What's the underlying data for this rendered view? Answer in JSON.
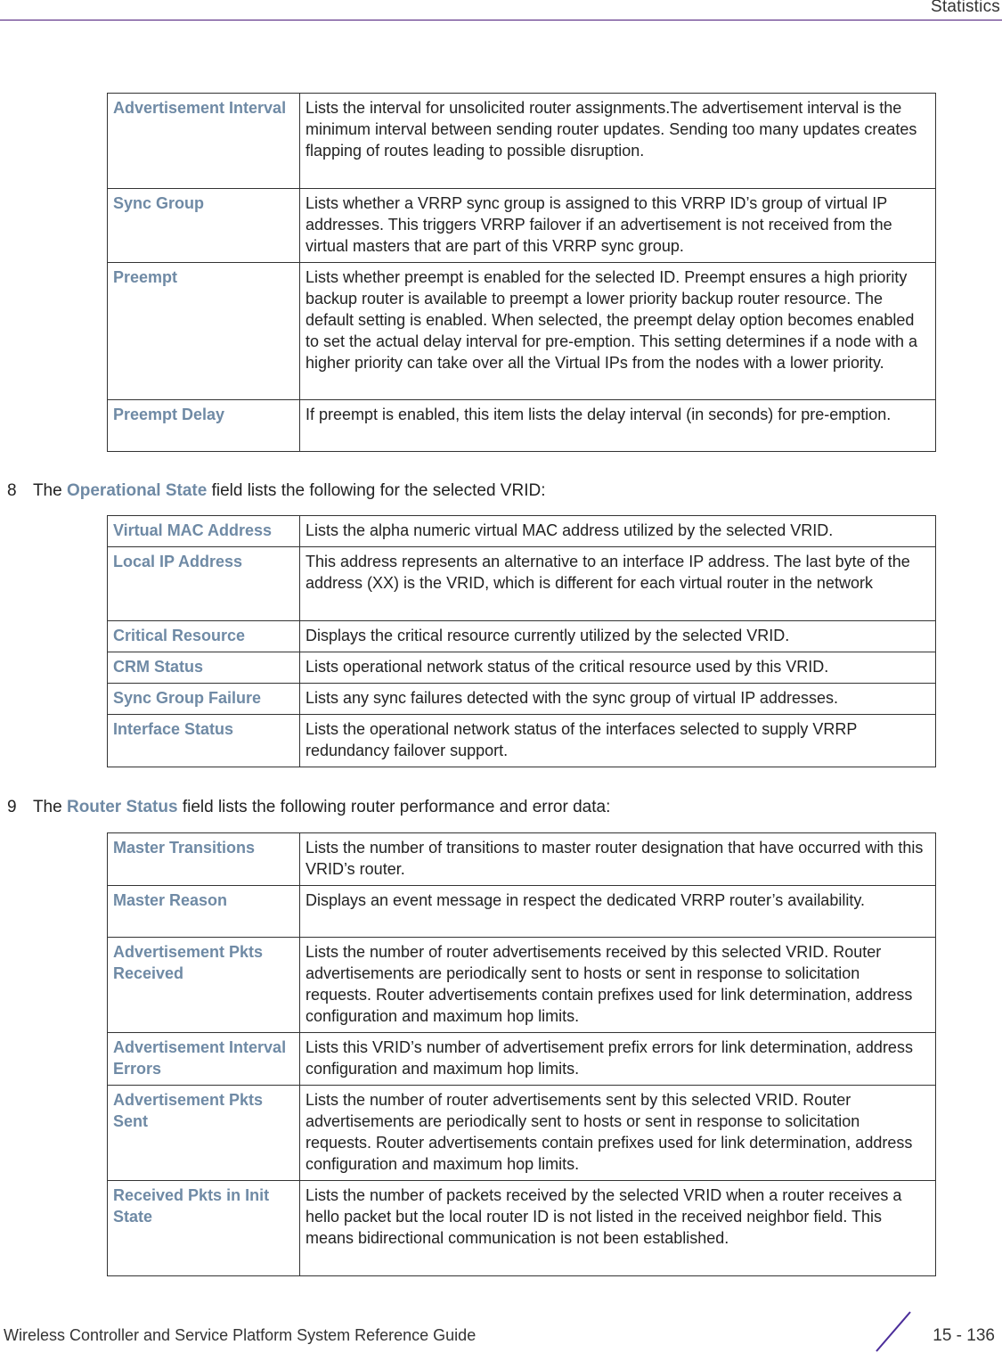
{
  "header": {
    "title": "Statistics",
    "rule_color": "#4b1a7a"
  },
  "table1": {
    "rows": [
      {
        "term": "Advertisement Interval",
        "desc": "Lists the interval for unsolicited router assignments.The advertisement interval is the minimum interval between sending router updates. Sending too many updates creates flapping of routes leading to possible disruption."
      },
      {
        "term": "Sync Group",
        "desc": "Lists whether a VRRP sync group is assigned to this VRRP ID’s group of virtual IP addresses. This triggers VRRP failover if an advertisement is not received from the virtual masters that are part of this VRRP sync group."
      },
      {
        "term": "Preempt",
        "desc": "Lists whether preempt is enabled for the selected ID. Preempt ensures a high priority backup router is available to preempt a lower priority backup router resource. The default setting is enabled. When selected, the preempt delay option becomes enabled to set the actual delay interval for pre-emption. This setting determines if a node with a higher priority can take over all the Virtual IPs from the nodes with a lower priority."
      },
      {
        "term": "Preempt Delay",
        "desc": "If preempt is enabled, this item lists the delay interval (in seconds) for pre-emption."
      }
    ]
  },
  "step8": {
    "number": "8",
    "prefix": "The",
    "highlight": "Operational State",
    "suffix": "field lists the following for the selected VRID:"
  },
  "table2": {
    "rows": [
      {
        "term": "Virtual MAC Address",
        "desc": "Lists the alpha numeric virtual MAC address utilized by the selected VRID."
      },
      {
        "term": "Local IP Address",
        "desc": "This address represents an alternative to an interface IP address. The last byte of the address (XX) is the VRID, which is different for each virtual router in the network"
      },
      {
        "term": "Critical Resource",
        "desc": "Displays the critical resource currently utilized by the selected VRID."
      },
      {
        "term": "CRM Status",
        "desc": "Lists operational network status of the critical resource used by this VRID."
      },
      {
        "term": "Sync Group Failure",
        "desc": "Lists any sync failures detected with the sync group of virtual IP addresses."
      },
      {
        "term": "Interface Status",
        "desc": "Lists the operational network status of the interfaces selected to supply VRRP redundancy failover support."
      }
    ]
  },
  "step9": {
    "number": "9",
    "prefix": "The",
    "highlight": "Router Status",
    "suffix": "field lists the following router performance and error data:"
  },
  "table3": {
    "rows": [
      {
        "term": "Master Transitions",
        "desc": "Lists the number of transitions to master router designation that have occurred with this VRID’s router."
      },
      {
        "term": "Master Reason",
        "desc": "Displays an event message in respect the dedicated VRRP router’s availability."
      },
      {
        "term": "Advertisement Pkts Received",
        "desc": "Lists the number of router advertisements received by this selected VRID. Router advertisements are periodically sent to hosts or sent in response to solicitation requests. Router advertisements contain prefixes used for link determination, address configuration and maximum hop limits."
      },
      {
        "term": "Advertisement Interval Errors",
        "desc": "Lists this VRID’s number of advertisement prefix errors for link determination, address configuration and maximum hop limits."
      },
      {
        "term": "Advertisement Pkts Sent",
        "desc": "Lists the number of router advertisements sent by this selected VRID. Router advertisements are periodically sent to hosts or sent in response to solicitation requests. Router advertisements contain prefixes used for link determination, address configuration and maximum hop limits."
      },
      {
        "term": "Received Pkts in Init State",
        "desc": "Lists the number of packets received by the selected VRID when a router receives a hello packet but the local router ID is not listed in the received neighbor field. This means bidirectional communication is not been established."
      }
    ]
  },
  "footer": {
    "guide_title": "Wireless Controller and Service Platform System Reference Guide",
    "page_number": "15 - 136",
    "accent_color": "#4b2d9a"
  },
  "colors": {
    "term": "#6f8aa5",
    "text": "#222222"
  }
}
